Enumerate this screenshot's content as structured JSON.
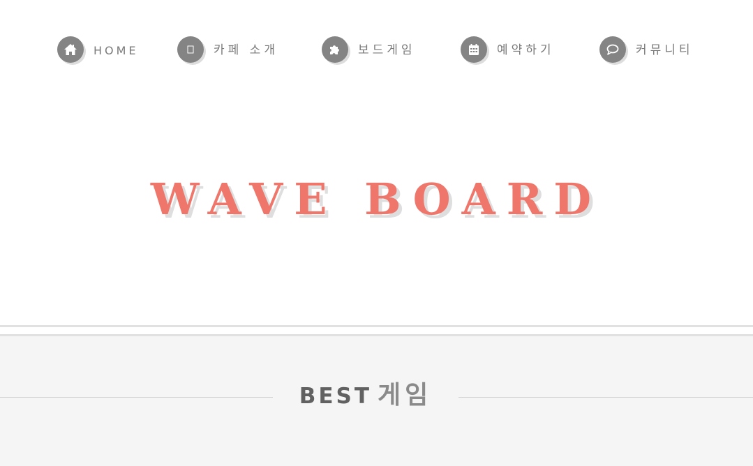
{
  "nav": {
    "items": [
      {
        "label": "HOME",
        "icon": "home-icon"
      },
      {
        "label": "카페 소개",
        "icon": "square-icon"
      },
      {
        "label": "보드게임",
        "icon": "puzzle-icon"
      },
      {
        "label": "예약하기",
        "icon": "calendar-icon"
      },
      {
        "label": "커뮤니티",
        "icon": "speech-bubble-icon"
      }
    ],
    "icon_bg": "#848484",
    "label_color": "#7a7a7a"
  },
  "hero": {
    "logo": "WAVE BOARD",
    "logo_color": "#ef766b"
  },
  "section": {
    "title_strong": "BEST",
    "title_light": "게임",
    "background": "#f5f5f5"
  }
}
